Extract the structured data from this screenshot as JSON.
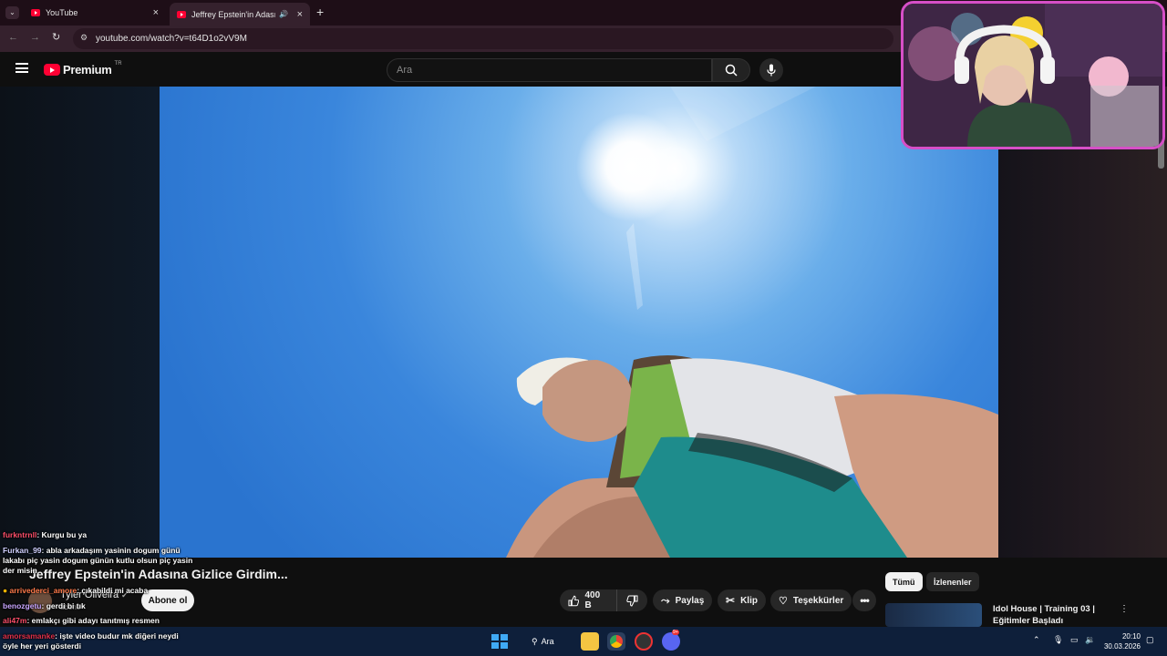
{
  "browser": {
    "tabs": [
      {
        "label": "YouTube"
      },
      {
        "label": "Jeffrey Epstein'in Adasına G"
      }
    ],
    "url": "youtube.com/watch?v=t64D1o2vV9M"
  },
  "youtube": {
    "brand": "Premium",
    "region": "TR",
    "search_placeholder": "Ara"
  },
  "video": {
    "title": "Jeffrey Epstein'in Adasına Gizlice Girdim...",
    "channel": "Tyler Oliveira",
    "subscribers": "abone",
    "subscribe_label": "Abone ol",
    "likes": "400 B",
    "share_label": "Paylaş",
    "clip_label": "Klip",
    "thanks_label": "Teşekkürler"
  },
  "recommendations": {
    "chips": [
      "Tümü",
      "İzlenenler"
    ],
    "first": {
      "title": "Idol House | Training 03 | Eğitimler Başladı"
    }
  },
  "chat": [
    {
      "user": "furkntrnll",
      "message": ": Kurgu bu ya"
    },
    {
      "user": "Furkan_99",
      "message": ": abla arkadaşım yasinin dogum günü lakabı piç yasin dogum günün kutlu olsun piç yasin der misin"
    },
    {
      "user": "arrivederci_amore",
      "message": ": çıkabildi mi acaba"
    },
    {
      "user": "benozgetu",
      "message": ": gerdi bi tık"
    },
    {
      "user": "ali47m",
      "message": ": emlakçı gibi adayı tanıtmış resmen"
    },
    {
      "user": "amorsamanke",
      "message": ": işte video budur mk diğeri neydi öyle her yeri gösterdi"
    }
  ],
  "taskbar": {
    "search_label": "Ara",
    "time": "20:10",
    "date": "30.03.2026",
    "discord_badge": "9+"
  }
}
